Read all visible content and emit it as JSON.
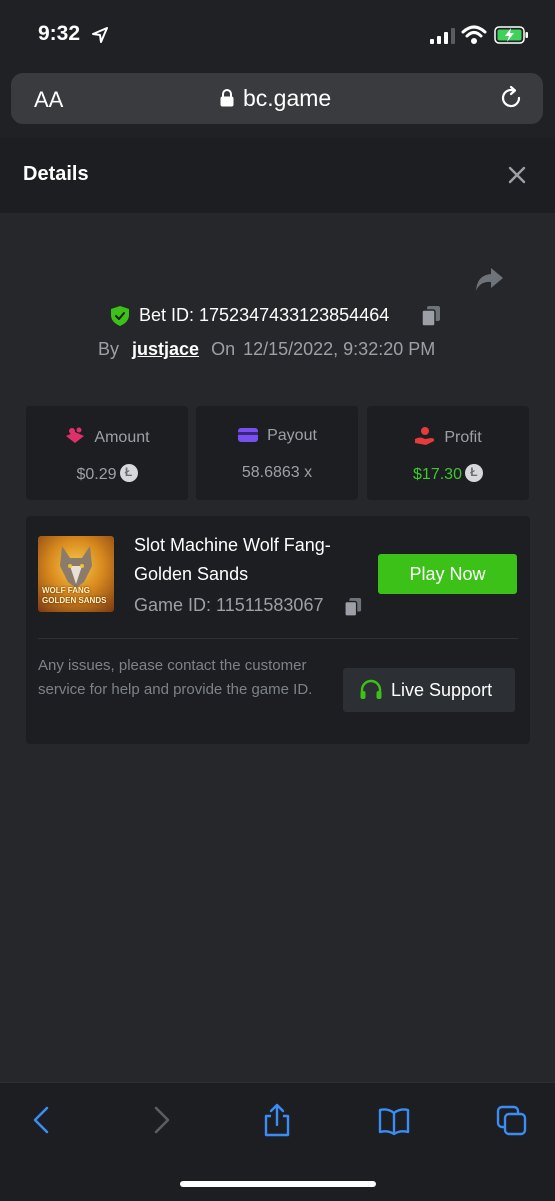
{
  "status_bar": {
    "time": "9:32",
    "icons": [
      "location-arrow-icon",
      "signal-icon",
      "wifi-icon",
      "battery-charging-icon"
    ]
  },
  "browser": {
    "text_size_label": "AA",
    "url": "bc.game",
    "icons": [
      "lock-icon",
      "reload-icon"
    ]
  },
  "modal": {
    "title": "Details",
    "bet_id_label": "Bet ID: 1752347433123854464",
    "by_label": "By",
    "username": "justjace",
    "on_label": "On",
    "datetime": "12/15/2022, 9:32:20 PM"
  },
  "stats": [
    {
      "label": "Amount",
      "value": "$0.29",
      "icon": "amount-icon"
    },
    {
      "label": "Payout",
      "value": "58.6863 x",
      "icon": "payout-card-icon"
    },
    {
      "label": "Profit",
      "value": "$17.30",
      "icon": "profit-hand-icon"
    }
  ],
  "game": {
    "title": "Slot Machine Wolf Fang-Golden Sands",
    "thumb_text": "WOLF FANG GOLDEN SANDS",
    "game_id_label": "Game ID: 11511583067",
    "play_label": "Play Now",
    "help_text": "Any issues, please contact the customer service for help and provide the game ID.",
    "support_label": "Live Support"
  },
  "toolbar": {
    "icons": [
      "back-icon",
      "forward-icon",
      "share-icon",
      "bookmarks-icon",
      "tabs-icon"
    ]
  },
  "colors": {
    "accent_green": "#3bc117",
    "profit_green": "#3ec72f",
    "amount_pink": "#e0306a",
    "payout_purple": "#7a4ff0",
    "profit_red": "#e53b3b",
    "ios_blue": "#3b8cf5"
  }
}
